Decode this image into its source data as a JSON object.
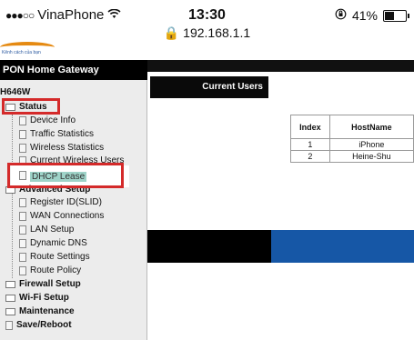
{
  "statusbar": {
    "carrier": "VinaPhone",
    "time": "13:30",
    "url": "192.168.1.1",
    "battery_text": "41%",
    "battery_level": 0.41
  },
  "logo": {
    "tagline": "Kênh cách của bạn"
  },
  "gateway_title": "PON Home Gateway",
  "model": "H646W",
  "menu": {
    "status": "Status",
    "device_info": "Device Info",
    "traffic_statistics": "Traffic Statistics",
    "wireless_statistics": "Wireless Statistics",
    "current_wireless_users": "Current Wireless Users",
    "dhcp_lease": "DHCP Lease",
    "advanced_setup": "Advanced Setup",
    "register_id": "Register ID(SLID)",
    "wan_connections": "WAN Connections",
    "lan_setup": "LAN Setup",
    "dynamic_dns": "Dynamic DNS",
    "route_settings": "Route Settings",
    "route_policy": "Route Policy",
    "firewall_setup": "Firewall Setup",
    "wifi_setup": "Wi-Fi Setup",
    "maintenance": "Maintenance",
    "save_reboot": "Save/Reboot"
  },
  "content": {
    "section_title": "Current Users",
    "table": {
      "headers": [
        "Index",
        "HostName"
      ],
      "rows": [
        [
          "1",
          "iPhone"
        ],
        [
          "2",
          "Heine-Shu"
        ]
      ]
    }
  },
  "colors": {
    "highlight_red": "#d42a2a",
    "accent_blue": "#1657a6",
    "logo_orange": "#e58a12"
  }
}
